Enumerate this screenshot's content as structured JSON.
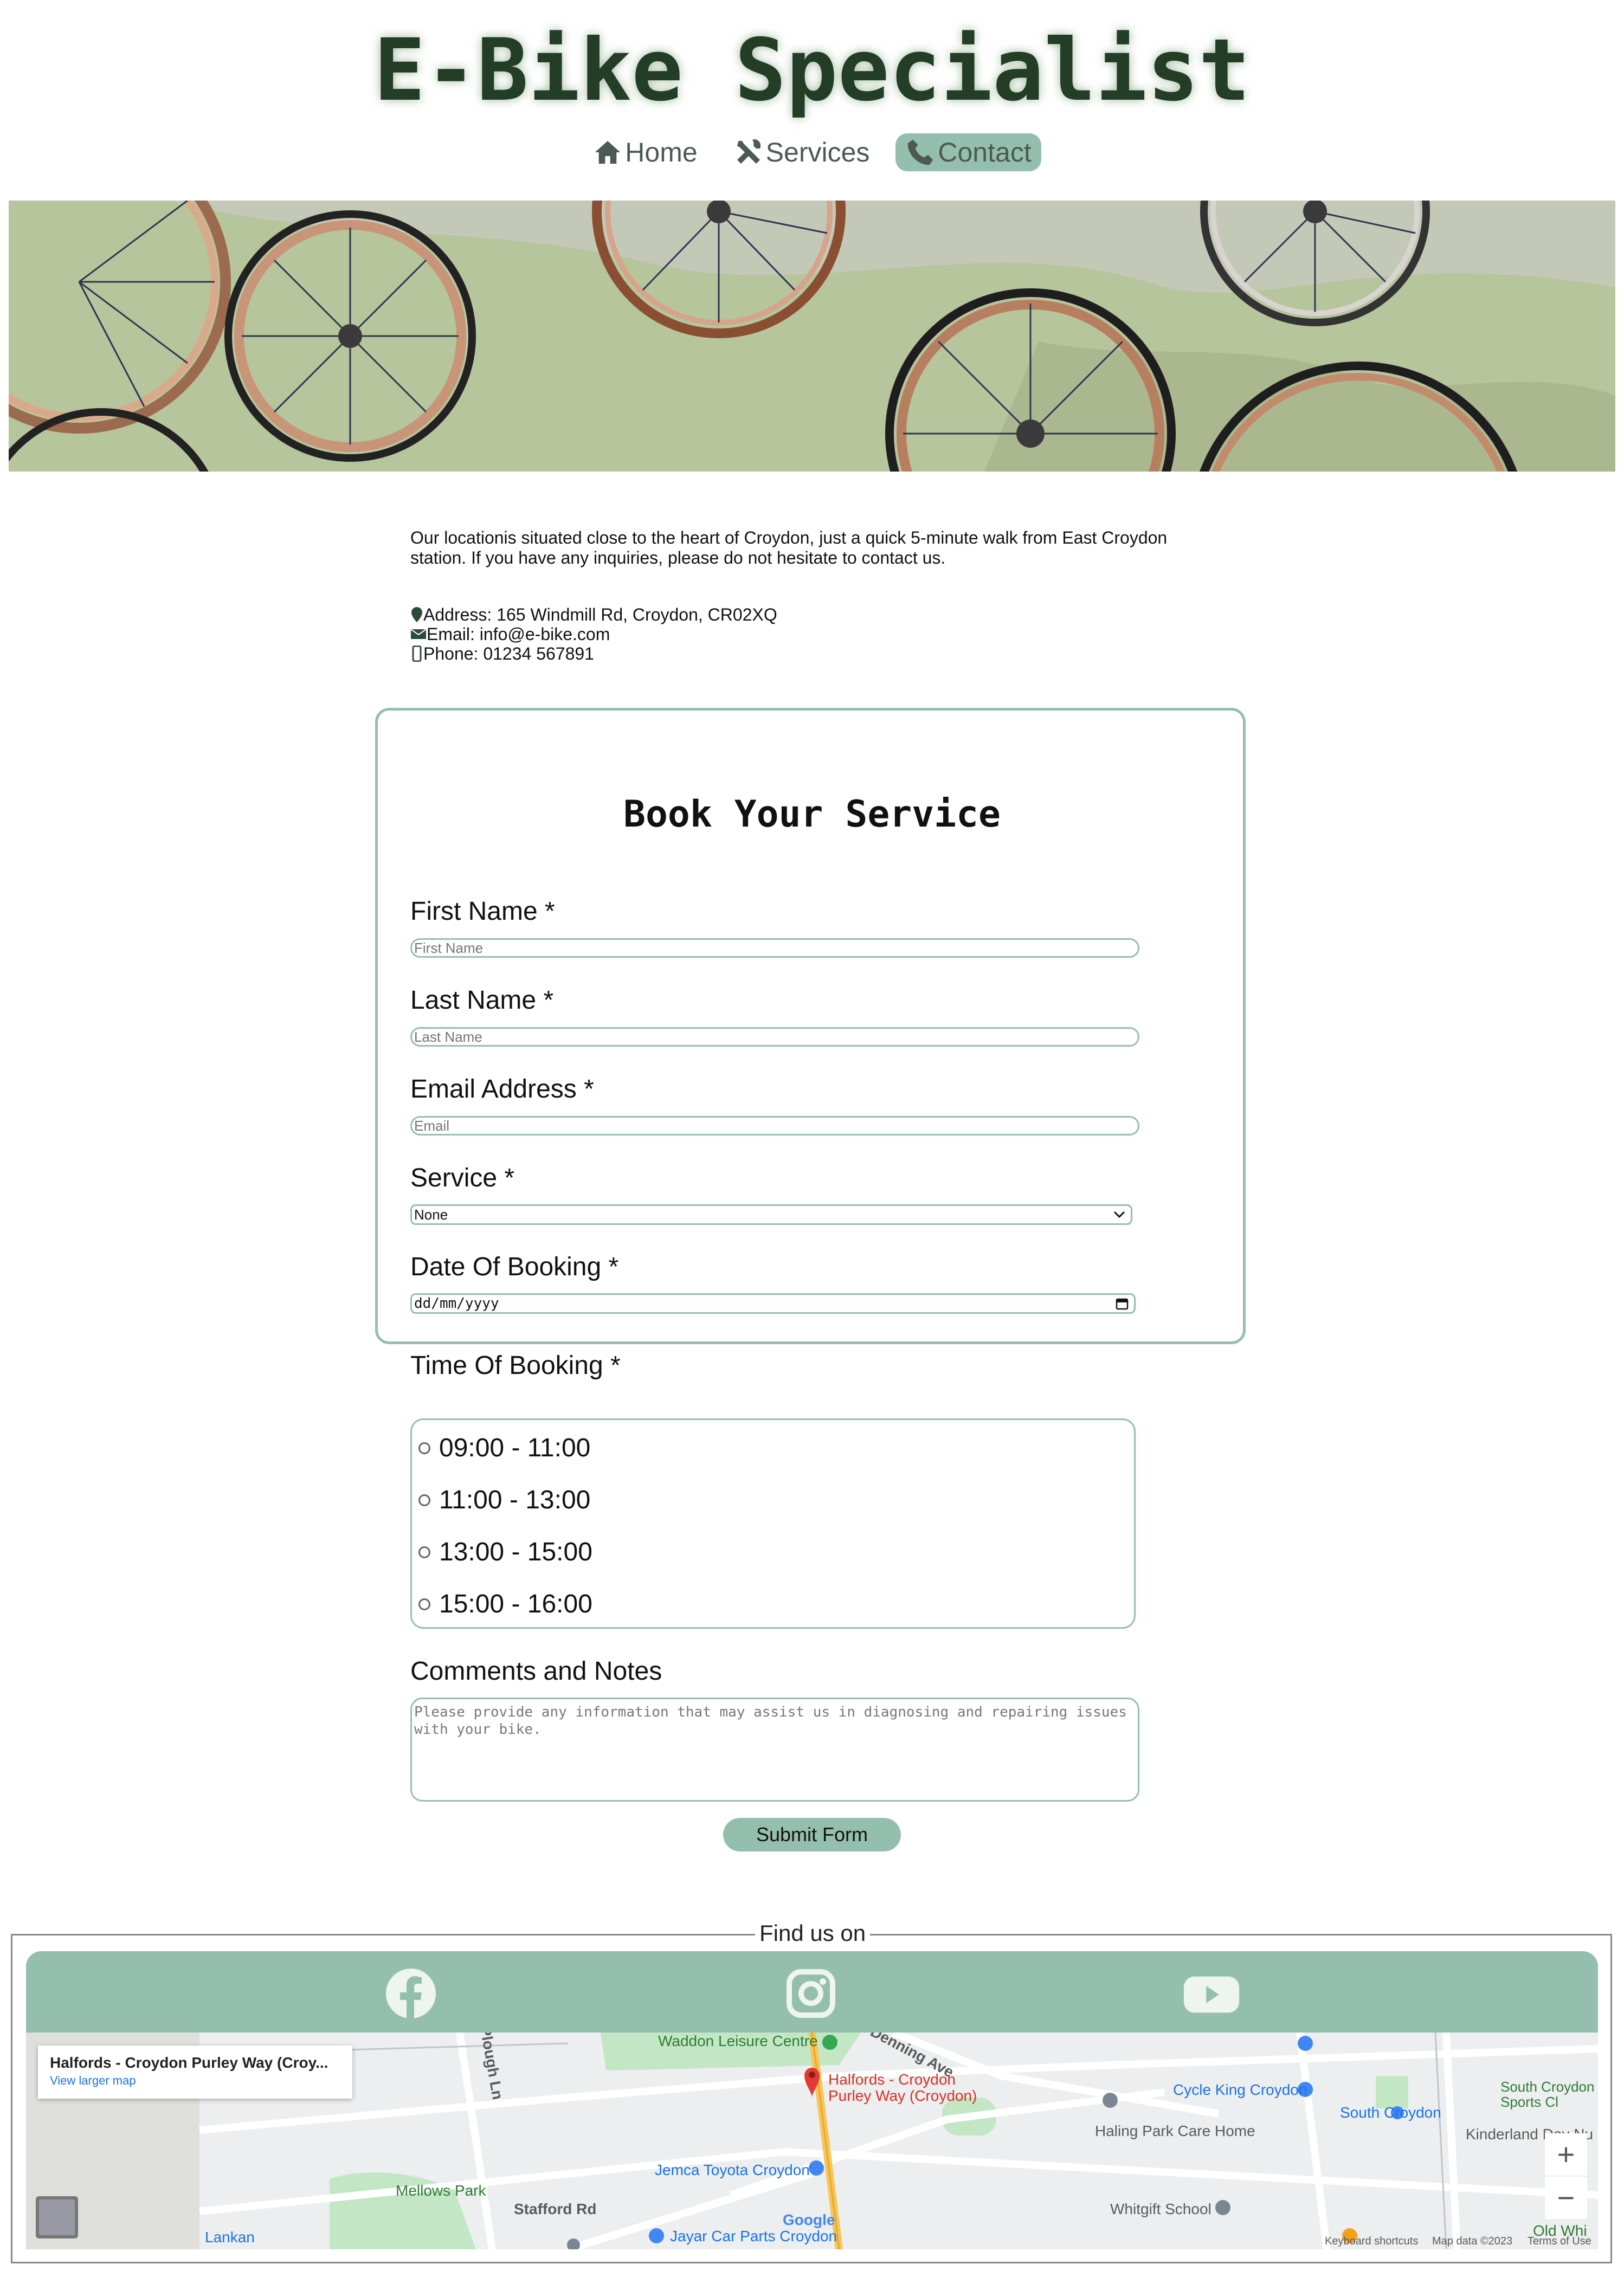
{
  "site": {
    "title": "E-Bike Specialist"
  },
  "nav": {
    "items": [
      {
        "label": "Home",
        "icon": "home-icon"
      },
      {
        "label": "Services",
        "icon": "tools-icon"
      },
      {
        "label": "Contact",
        "icon": "phone-icon",
        "active": true
      }
    ]
  },
  "intro": {
    "text": "Our locationis situated close to the heart of Croydon, just a quick 5-minute walk from East Croydon station. If you have any inquiries, please do not hesitate to contact us."
  },
  "contact": {
    "address": "Address: 165 Windmill Rd, Croydon, CR02XQ",
    "email": "Email: info@e-bike.com",
    "phone": "Phone: 01234 567891"
  },
  "form": {
    "title": "Book Your Service",
    "first_name_label": "First Name *",
    "first_name_placeholder": "First Name",
    "last_name_label": "Last Name *",
    "last_name_placeholder": "Last Name",
    "email_label": "Email Address *",
    "email_placeholder": "Email",
    "service_label": "Service *",
    "service_value": "None",
    "date_label": "Date Of Booking *",
    "date_placeholder": "dd/mm/yyyy",
    "time_label": "Time Of Booking *",
    "time_slots": [
      "09:00 - 11:00",
      "11:00 - 13:00",
      "13:00 - 15:00",
      "15:00 - 16:00"
    ],
    "comments_label": "Comments and Notes",
    "comments_placeholder": "Please provide any information that may assist us in diagnosing and repairing issues with your bike.",
    "submit_label": "Submit Form"
  },
  "footer": {
    "find_us": "Find us on",
    "social": [
      "facebook-icon",
      "instagram-icon",
      "youtube-icon"
    ]
  },
  "map": {
    "card_title": "Halfords - Croydon Purley Way (Croy...",
    "card_link": "View larger map",
    "places": {
      "waddon": "Waddon Leisure Centre",
      "halfords": "Halfords - Croydon Purley Way (Croydon)",
      "jemca": "Jemca Toyota Croydon",
      "jayar": "Jayar Car Parts Croydon",
      "cycle_king": "Cycle King Croydon",
      "haling": "Haling Park Care Home",
      "south_croydon": "South Croydon",
      "south_croydon_sports": "South Croydon Sports Cl",
      "kinderland": "Kinderland Day Nu",
      "mellows": "Mellows Park",
      "whitgift": "Whitgift School",
      "lankan": "Lankan",
      "stafford_rd": "Stafford Rd",
      "denning": "Denning Ave",
      "plough": "Plough Ln",
      "old_whi": "Old Whi"
    },
    "attribution": {
      "keyboard": "Keyboard shortcuts",
      "data": "Map data ©2023",
      "terms": "Terms of Use"
    },
    "google": "Google",
    "colors": {
      "park": "#c3e6c5",
      "road_major": "#f7c654",
      "accent": "#94bfae"
    }
  }
}
